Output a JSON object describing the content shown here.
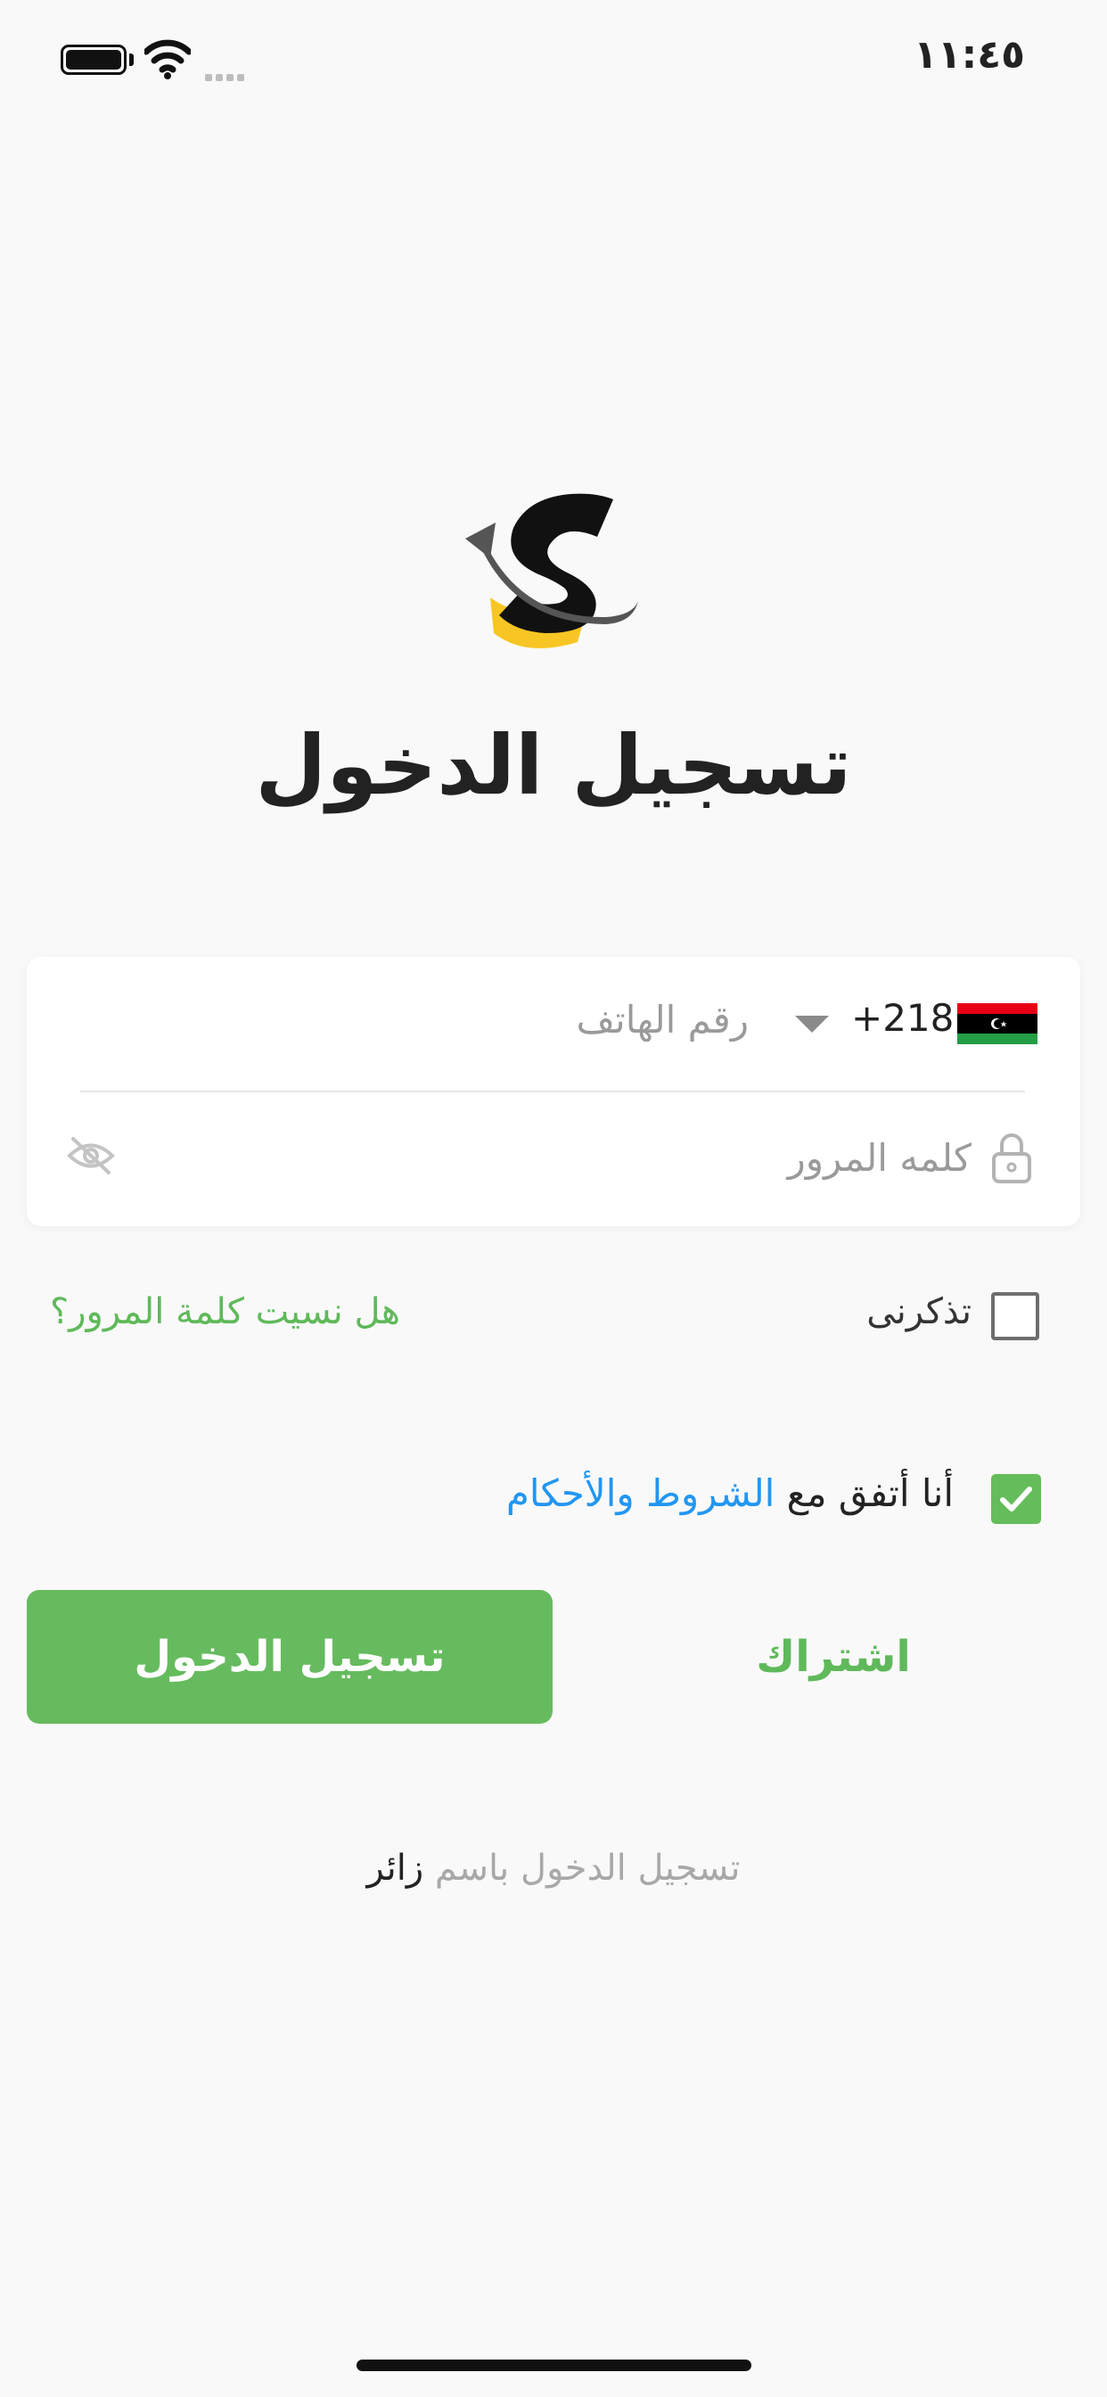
{
  "status_bar": {
    "time": "١١:٤٥"
  },
  "header": {
    "title": "تسجيل الدخول"
  },
  "phone": {
    "dial_code": "+218",
    "placeholder": "رقم الهاتف",
    "flag_colors": [
      "#e70013",
      "#000000",
      "#239e46"
    ]
  },
  "password": {
    "placeholder": "كلمه المرور"
  },
  "remember": {
    "label": "تذكرنى",
    "checked": false
  },
  "forgot": {
    "label": "هل نسيت كلمة المرور؟"
  },
  "terms": {
    "prefix": "أنا أتفق مع",
    "link": "الشروط والأحكام",
    "checked": true
  },
  "buttons": {
    "login": "تسجيل الدخول",
    "signup": "اشتراك"
  },
  "guest": {
    "prefix": "تسجيل الدخول باسم",
    "highlight": "زائر"
  },
  "colors": {
    "accent": "#66bb5e",
    "link": "#2196f3",
    "brand_yellow": "#f7c624"
  }
}
